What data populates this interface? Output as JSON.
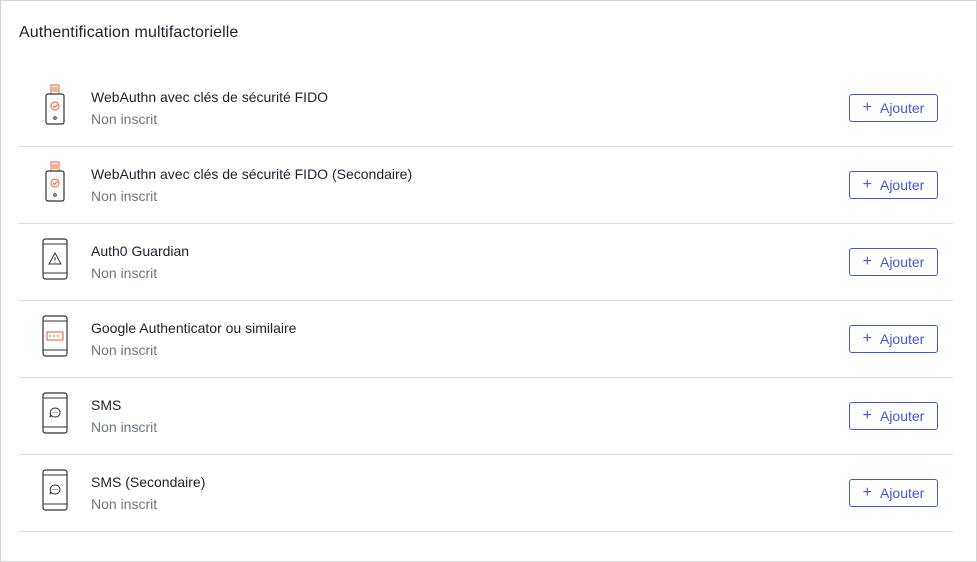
{
  "section": {
    "title": "Authentification multifactorielle"
  },
  "factors": [
    {
      "name": "WebAuthn avec clés de sécurité FIDO",
      "status": "Non inscrit",
      "icon": "security-key-icon",
      "button": "Ajouter"
    },
    {
      "name": "WebAuthn avec clés de sécurité FIDO (Secondaire)",
      "status": "Non inscrit",
      "icon": "security-key-icon",
      "button": "Ajouter"
    },
    {
      "name": "Auth0 Guardian",
      "status": "Non inscrit",
      "icon": "phone-warning-icon",
      "button": "Ajouter"
    },
    {
      "name": "Google Authenticator ou similaire",
      "status": "Non inscrit",
      "icon": "phone-code-icon",
      "button": "Ajouter"
    },
    {
      "name": "SMS",
      "status": "Non inscrit",
      "icon": "phone-sms-icon",
      "button": "Ajouter"
    },
    {
      "name": "SMS (Secondaire)",
      "status": "Non inscrit",
      "icon": "phone-sms-icon",
      "button": "Ajouter"
    }
  ],
  "colors": {
    "accent": "#3f59e4",
    "muted_text": "#6f7680",
    "icon_orange": "#e8612c"
  }
}
